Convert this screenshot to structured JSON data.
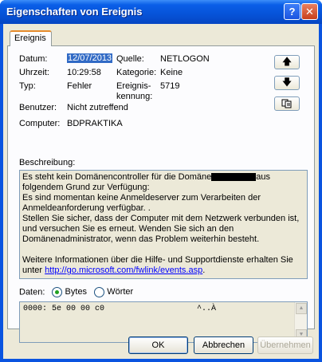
{
  "window": {
    "title": "Eigenschaften von Ereignis"
  },
  "tab": {
    "label": "Ereignis"
  },
  "fields": {
    "datum_label": "Datum:",
    "datum_value": "12/07/2013",
    "uhrzeit_label": "Uhrzeit:",
    "uhrzeit_value": "10:29:58",
    "typ_label": "Typ:",
    "typ_value": "Fehler",
    "benutzer_label": "Benutzer:",
    "benutzer_value": "Nicht zutreffend",
    "computer_label": "Computer:",
    "computer_value": "BDPRAKTIKA",
    "quelle_label": "Quelle:",
    "quelle_value": "NETLOGON",
    "kategorie_label": "Kategorie:",
    "kategorie_value": "Keine",
    "kennung_label_1": "Ereignis-",
    "kennung_label_2": "kennung:",
    "kennung_value": "5719"
  },
  "description": {
    "label": "Beschreibung:",
    "line1_a": "Es steht kein Domänencontroller für die Domäne",
    "line1_b": "aus",
    "line2": "folgendem Grund zur Verfügung:",
    "line3": "Es sind momentan keine Anmeldeserver zum Verarbeiten der",
    "line4": "Anmeldeanforderung verfügbar. .",
    "line5": "Stellen Sie sicher, dass der Computer mit dem Netzwerk verbunden ist,",
    "line6": "und versuchen Sie es erneut. Wenden Sie sich an den",
    "line7": "Domänenadministrator, wenn das Problem weiterhin besteht.",
    "line8": "Weitere Informationen über die Hilfe- und Supportdienste erhalten Sie",
    "line9_a": "unter",
    "link": "http://go.microsoft.com/fwlink/events.asp",
    "line9_b": "."
  },
  "data_section": {
    "label": "Daten:",
    "option_bytes": "Bytes",
    "option_words": "Wörter",
    "selected": "Bytes",
    "hex_line": "0000: 5e 00 00 c0",
    "ascii_line": "^..À"
  },
  "buttons": {
    "ok": "OK",
    "cancel": "Abbrechen",
    "apply": "Übernehmen"
  },
  "icons": {
    "up": "up-arrow-icon",
    "down": "down-arrow-icon",
    "copy": "copy-icon",
    "help": "help-icon",
    "close": "close-icon"
  }
}
